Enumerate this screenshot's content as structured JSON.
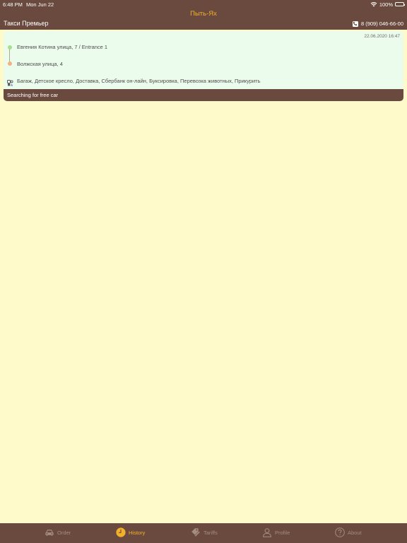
{
  "status_bar": {
    "time": "6:48 PM",
    "date": "Mon Jun 22",
    "battery": "100%"
  },
  "header": {
    "city": "Пыть-Ях",
    "company": "Такси Премьер",
    "phone": "8 (909) 046-66-00"
  },
  "order": {
    "datetime": "22.06.2020 16:47",
    "from": "Евгения Котина улица, 7 / Entrance 1",
    "to": "Волжская улица, 4",
    "options": "Багаж, Детское кресло, Доставка, Сбербанк он-лайн, Буксировка, Перевозка животных, Прикурить",
    "status": "Searching for free car"
  },
  "tabs": [
    {
      "label": "Order",
      "icon": "car-icon",
      "active": false
    },
    {
      "label": "History",
      "icon": "clock-icon",
      "active": true
    },
    {
      "label": "Tariffs",
      "icon": "tags-icon",
      "active": false
    },
    {
      "label": "Profile",
      "icon": "person-icon",
      "active": false
    },
    {
      "label": "About",
      "icon": "question-icon",
      "active": false
    }
  ],
  "colors": {
    "header_bg": "#6a4a3e",
    "page_bg": "#fefac9",
    "accent": "#f3b12b",
    "card_bg": "#ecfcec",
    "from_dot": "#a6e08a",
    "to_dot": "#f3b27e"
  }
}
